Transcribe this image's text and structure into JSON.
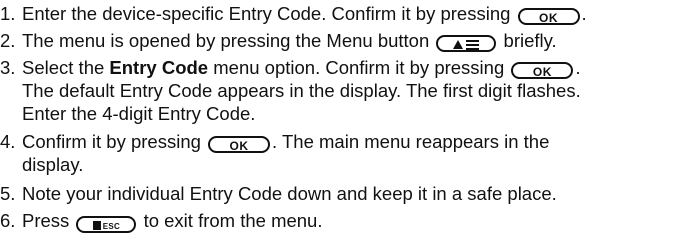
{
  "steps": [
    {
      "num": "1.",
      "a": "Enter the device-specific Entry Code. Confirm it by pressing",
      "b": "."
    },
    {
      "num": "2.",
      "a": "The menu is opened by pressing the Menu button",
      "b": "briefly."
    },
    {
      "num": "3.",
      "a": "Select the",
      "bold": "Entry Code",
      "b": "menu option. Confirm it by pressing",
      "c": ".",
      "line2": "The default Entry Code appears in the display. The first digit flashes.",
      "line3": "Enter the 4-digit Entry Code."
    },
    {
      "num": "4.",
      "a": "Confirm it by pressing",
      "b": ". The main menu reappears in the",
      "line2": "display."
    },
    {
      "num": "5.",
      "a": "Note your individual Entry Code down and keep it in a safe place."
    },
    {
      "num": "6.",
      "a": "Press",
      "b": "to exit from the menu."
    }
  ],
  "keys": {
    "ok": "OK",
    "esc": "ESC"
  },
  "icons": {
    "ok_button": "ok-button-icon",
    "menu_button": "menu-button-icon",
    "esc_button": "esc-button-icon"
  }
}
